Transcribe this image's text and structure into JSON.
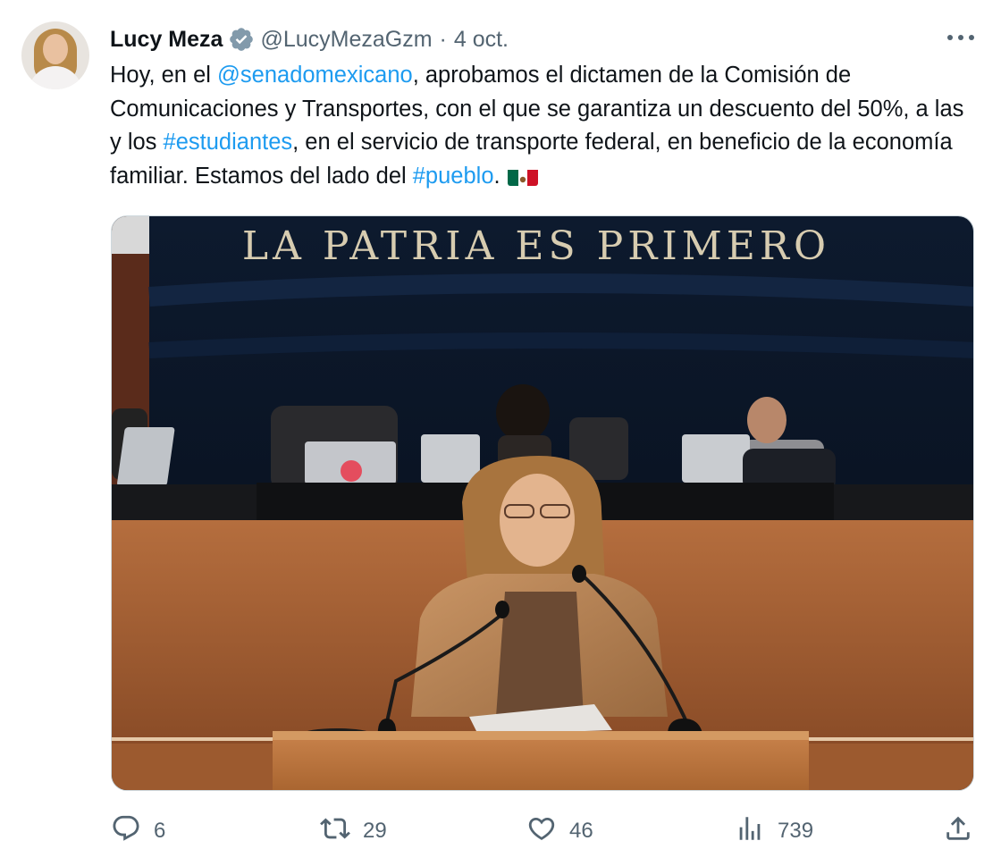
{
  "tweet": {
    "author_name": "Lucy Meza",
    "handle": "@LucyMezaGzm",
    "separator": "·",
    "date": "4 oct.",
    "text": {
      "p1": "Hoy, en el ",
      "mention": "@senadomexicano",
      "p2": ", aprobamos el dictamen de la Comisión de Comunicaciones y Transportes, con el que se garantiza un descuento del 50%, a las y los ",
      "hashtag1": "#estudiantes",
      "p3": ", en el servicio de transporte federal, en beneficio de la economía familiar. Estamos del lado del ",
      "hashtag2": "#pueblo",
      "p4": "."
    },
    "flag_icon": "mexico-flag-emoji",
    "media": {
      "banner_text": "LA PATRIA ES PRIMERO"
    },
    "actions": {
      "replies": "6",
      "retweets": "29",
      "likes": "46",
      "views": "739"
    },
    "colors": {
      "link": "#1d9bf0",
      "secondary_text": "#536471",
      "verified_badge": "#829aab"
    }
  }
}
